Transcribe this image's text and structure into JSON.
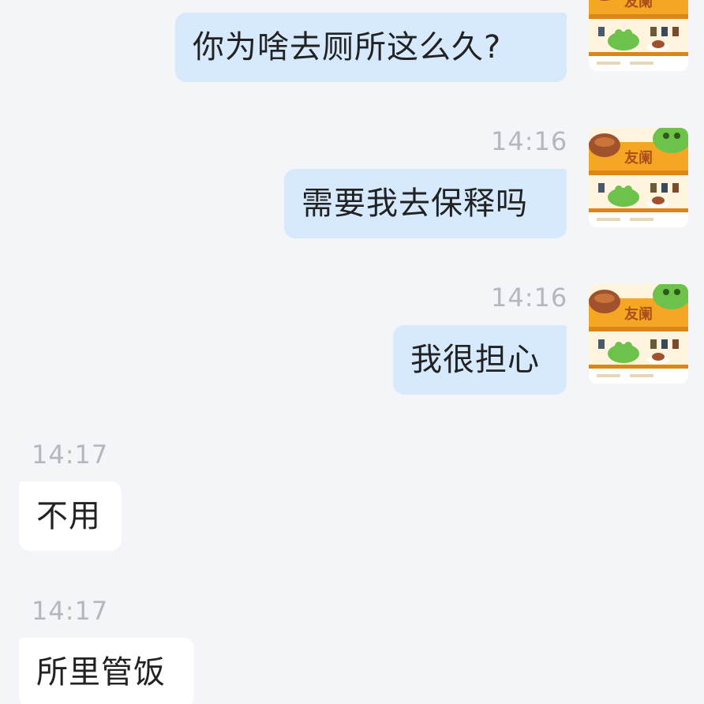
{
  "messages": [
    {
      "side": "out",
      "text": "你为啥去厕所这么久?"
    },
    {
      "side": "out",
      "time": "14:16",
      "text": "需要我去保释吗"
    },
    {
      "side": "out",
      "time": "14:16",
      "text": "我很担心"
    },
    {
      "side": "in",
      "time": "14:17",
      "text": "不用"
    },
    {
      "side": "in",
      "time": "14:17",
      "text": "所里管饭"
    }
  ],
  "avatar": {
    "label": "友阑",
    "icon": "frog-cafe-avatar-icon"
  },
  "colors": {
    "background": "#f3f5f8",
    "outgoing_bubble": "#d6e9fd",
    "incoming_bubble": "#ffffff",
    "timestamp": "#b4b8bd",
    "avatar_orange": "#f5a623",
    "avatar_frog": "#6cc24a"
  }
}
